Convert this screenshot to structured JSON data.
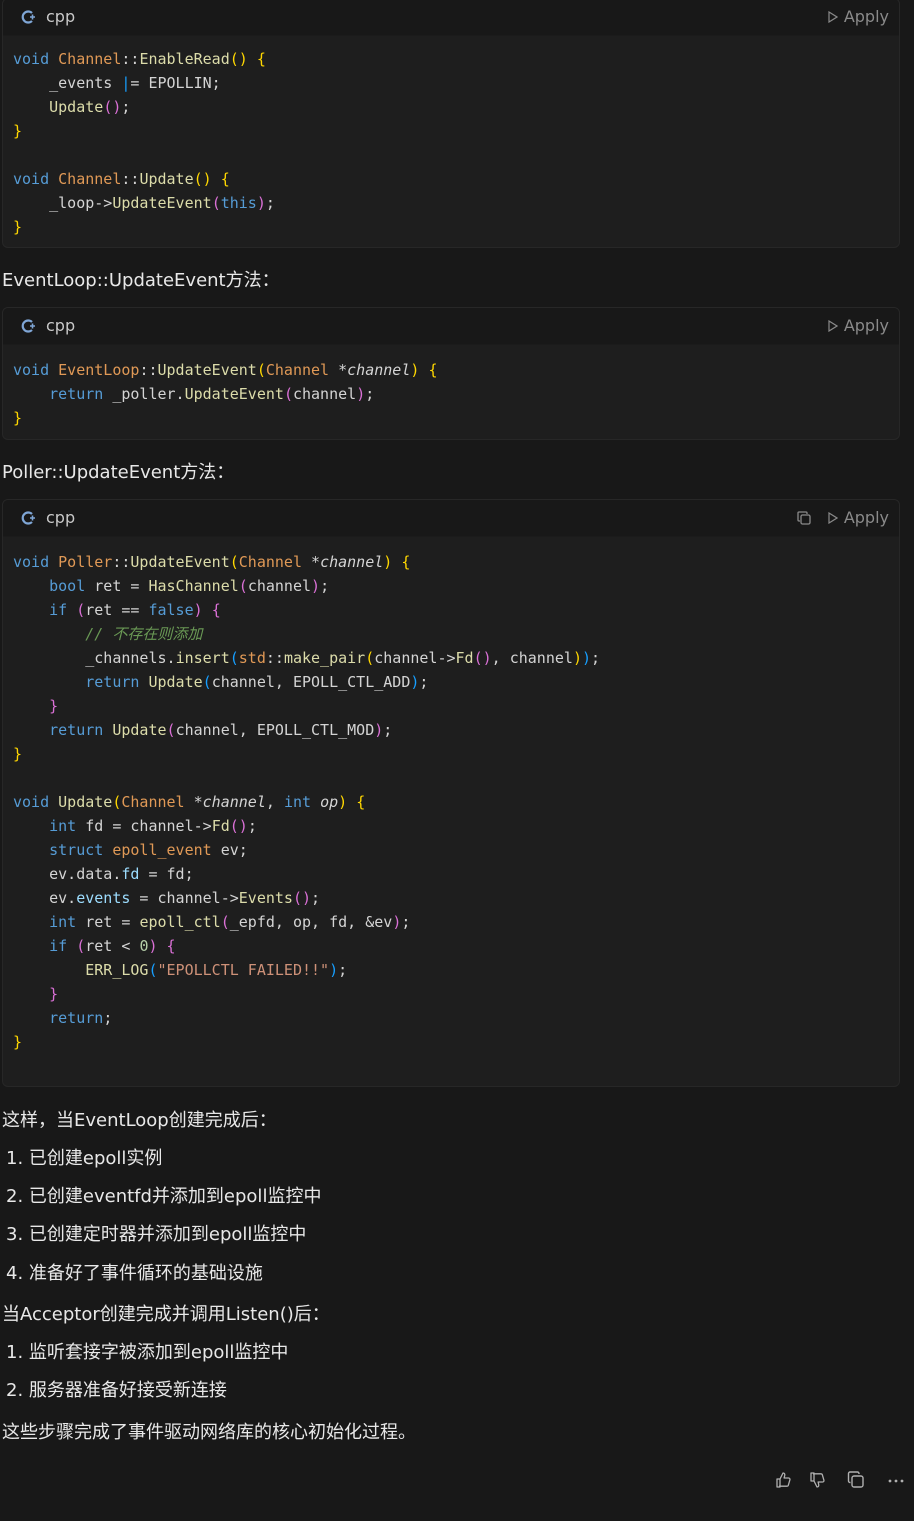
{
  "code_blocks": [
    {
      "language": "cpp",
      "apply_label": "Apply",
      "lines": [
        "void Channel::EnableRead() {",
        "    _events |= EPOLLIN;",
        "    Update();",
        "}",
        "",
        "void Channel::Update() {",
        "    _loop->UpdateEvent(this);",
        "}"
      ]
    },
    {
      "language": "cpp",
      "apply_label": "Apply",
      "lines": [
        "void EventLoop::UpdateEvent(Channel *channel) {",
        "    return _poller.UpdateEvent(channel);",
        "}"
      ]
    },
    {
      "language": "cpp",
      "apply_label": "Apply",
      "lines": [
        "void Poller::UpdateEvent(Channel *channel) {",
        "    bool ret = HasChannel(channel);",
        "    if (ret == false) {",
        "        // 不存在则添加",
        "        _channels.insert(std::make_pair(channel->Fd(), channel));",
        "        return Update(channel, EPOLL_CTL_ADD);",
        "    }",
        "    return Update(channel, EPOLL_CTL_MOD);",
        "}",
        "",
        "void Update(Channel *channel, int op) {",
        "    int fd = channel->Fd();",
        "    struct epoll_event ev;",
        "    ev.data.fd = fd;",
        "    ev.events = channel->Events();",
        "    int ret = epoll_ctl(_epfd, op, fd, &ev);",
        "    if (ret < 0) {",
        "        ERR_LOG(\"EPOLLCTL FAILED!!\");",
        "    }",
        "    return;",
        "}"
      ]
    }
  ],
  "headings": {
    "eventloop": "EventLoop::UpdateEvent方法：",
    "poller": "Poller::UpdateEvent方法："
  },
  "summary": {
    "intro1": "这样，当EventLoop创建完成后：",
    "list1": [
      "1. 已创建epoll实例",
      "2. 已创建eventfd并添加到epoll监控中",
      "3. 已创建定时器并添加到epoll监控中",
      "4. 准备好了事件循环的基础设施"
    ],
    "intro2": "当Acceptor创建完成并调用Listen()后：",
    "list2": [
      "1. 监听套接字被添加到epoll监控中",
      "2. 服务器准备好接受新连接"
    ],
    "conclusion": "这些步骤完成了事件驱动网络库的核心初始化过程。"
  },
  "footer_icons": [
    "thumbs-up-icon",
    "thumbs-down-icon",
    "copy-icon",
    "more-icon"
  ]
}
